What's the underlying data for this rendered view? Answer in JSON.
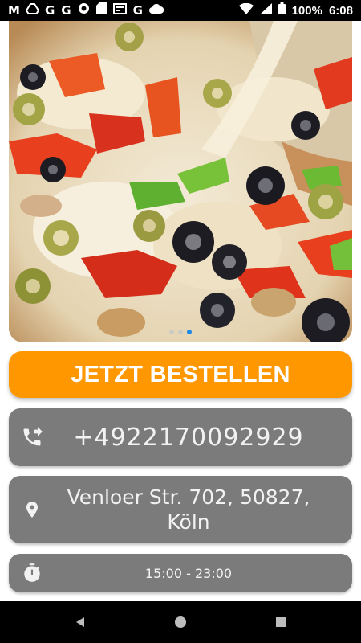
{
  "status_bar": {
    "icons_left": [
      "gmail-icon",
      "drive-icon",
      "google-icon",
      "google-icon",
      "assistant-icon",
      "sd-card-icon",
      "news-icon",
      "google-icon",
      "cloud-icon"
    ],
    "battery": "100%",
    "time": "6:08"
  },
  "hero": {
    "image": "pizza-closeup",
    "pages": 3,
    "active_page": 3
  },
  "order_button": {
    "label": "JETZT BESTELLEN",
    "color": "#ff9800"
  },
  "contact": {
    "phone": "+4922170092929",
    "address": "Venloer Str. 702, 50827, Köln",
    "hours": "15:00 - 23:00",
    "card_color": "#7b7b7b"
  },
  "nav": {
    "back": "back-icon",
    "home": "home-icon",
    "recents": "recents-icon"
  }
}
